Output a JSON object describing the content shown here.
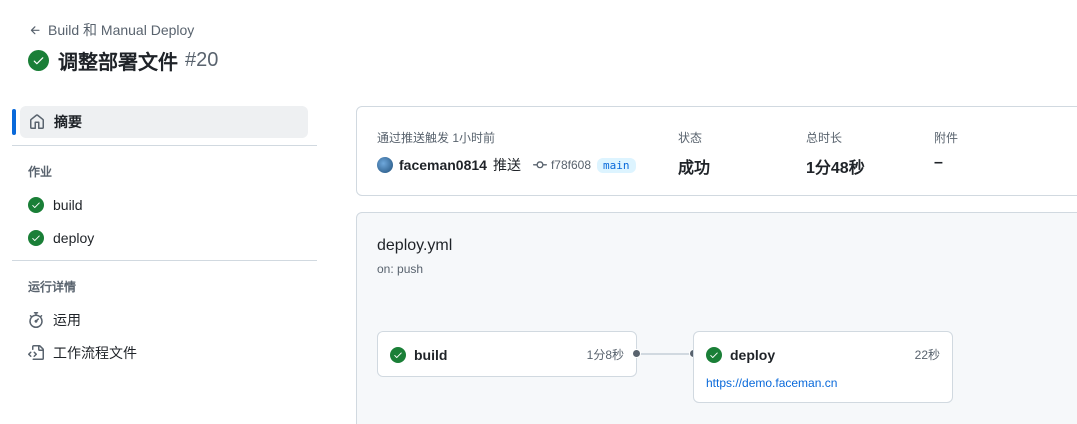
{
  "header": {
    "back_label": "Build 和 Manual Deploy",
    "title": "调整部署文件",
    "run_number": "#20"
  },
  "sidebar": {
    "summary_label": "摘要",
    "jobs_title": "作业",
    "jobs": [
      {
        "label": "build"
      },
      {
        "label": "deploy"
      }
    ],
    "details_title": "运行详情",
    "details": [
      {
        "label": "运用",
        "icon": "stopwatch-icon"
      },
      {
        "label": "工作流程文件",
        "icon": "file-code-icon"
      }
    ]
  },
  "summary": {
    "trigger_label": "通过推送触发 1小时前",
    "actor": "faceman0814",
    "action": "推送",
    "commit": "f78f608",
    "branch": "main",
    "status_label": "状态",
    "status_value": "成功",
    "duration_label": "总时长",
    "duration_value": "1分48秒",
    "artifacts_label": "附件",
    "artifacts_value": "–"
  },
  "workflow": {
    "file": "deploy.yml",
    "trigger": "on: push",
    "jobs": [
      {
        "name": "build",
        "duration": "1分8秒"
      },
      {
        "name": "deploy",
        "duration": "22秒",
        "link": "https://demo.faceman.cn"
      }
    ]
  },
  "colors": {
    "success": "#1a7f37",
    "accent": "#0969da",
    "muted": "#59636e"
  }
}
